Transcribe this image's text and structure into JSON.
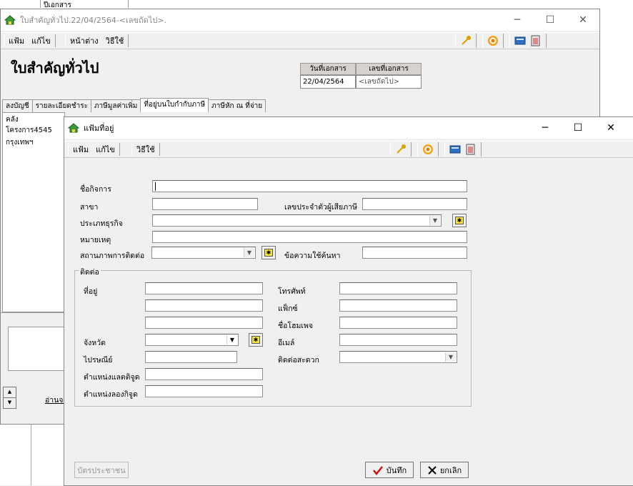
{
  "background": {
    "tab_label": "ปีเอกสาร"
  },
  "back_window": {
    "title": "ใบสำคัญทั่วไป.22/04/2564-<เลขถัดไป>.",
    "menu": {
      "file": "แฟ้ม",
      "edit": "แก้ไข",
      "window": "หน้าต่าง",
      "help": "วิธีใช้"
    },
    "heading": "ใบสำคัญทั่วไป",
    "doc_date_header": "วันที่เอกสาร",
    "doc_no_header": "เลขที่เอกสาร",
    "doc_date_value": "22/04/2564",
    "doc_no_value": "<เลขถัดไป>",
    "tabs": [
      "ลงบัญชี",
      "รายละเอียดชำระ",
      "ภาษีมูลค่าเพิ่ม",
      "ที่อยู่บนใบกำกับภาษี",
      "ภาษีหัก ณ ที่จ่าย"
    ],
    "content_line1": "คลังโครงการ4545",
    "content_line2": "กรุงเทพฯ",
    "link_partial": "อ่านจา"
  },
  "dialog": {
    "title": "แฟ้มที่อยู่",
    "menu": {
      "file": "แฟ้ม",
      "edit": "แก้ไข",
      "help": "วิธีใช้"
    },
    "labels": {
      "business_name": "ชื่อกิจการ",
      "branch": "สาขา",
      "tax_id": "เลขประจำตัวผู้เสียภาษี",
      "business_type": "ประเภทธุรกิจ",
      "note": "หมายเหตุ",
      "contact_status": "สถานภาพการติดต่อ",
      "search_text": "ข้อความใช้ค้นหา",
      "contact_group": "ติดต่อ",
      "address": "ที่อยู่",
      "province": "จังหวัด",
      "postcode": "ไปรษณีย์",
      "latitude": "ตำแหน่งแลตติจูด",
      "longitude": "ตำแหน่งลองกิจูด",
      "phone": "โทรศัพท์",
      "fax": "แฟ็กซ์",
      "homepage": "ชื่อโฮมเพจ",
      "email": "อีเมล์",
      "convenient_contact": "ติดต่อสะดวก"
    },
    "buttons": {
      "id_card": "บัตรประชาชน",
      "save": "บันทึก",
      "cancel": "ยกเลิก"
    }
  }
}
